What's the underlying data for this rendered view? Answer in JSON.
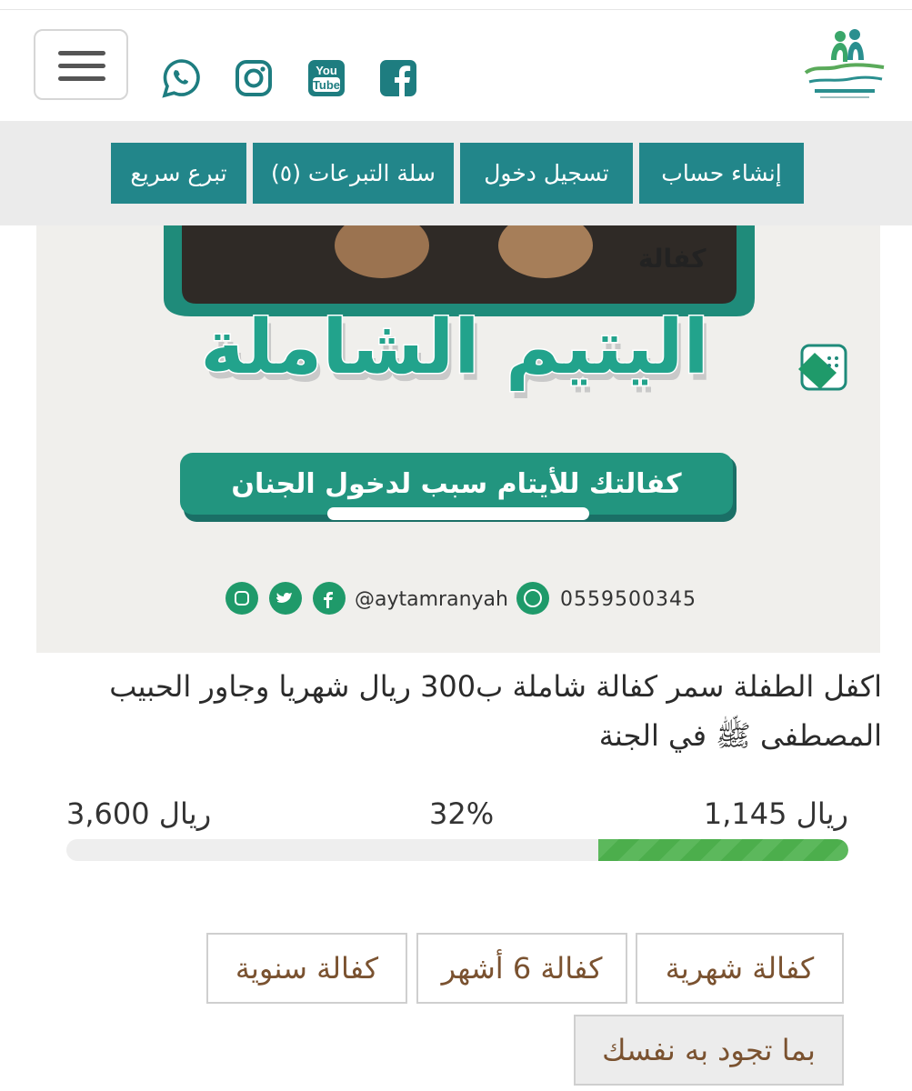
{
  "header": {
    "menu_label": "menu",
    "social": [
      "whatsapp-icon",
      "instagram-icon",
      "youtube-icon",
      "facebook-icon"
    ],
    "youtube_text_top": "You",
    "youtube_text_bottom": "Tube"
  },
  "nav": {
    "items": [
      {
        "label": "إنشاء حساب"
      },
      {
        "label": "تسجيل دخول"
      },
      {
        "label": "سلة التبرعات (٥)"
      },
      {
        "label": "تبرع سريع"
      }
    ]
  },
  "banner": {
    "caption_small": "كفالة",
    "caption_big": "اليتيم الشاملة",
    "tagline": "كفالتك للأيتام سبب لدخول الجنان",
    "handle": "@aytamranyah",
    "phone": "0559500345"
  },
  "campaign": {
    "title": "اكفل الطفلة سمر كفالة شاملة ب300 ريال شهريا وجاور الحبيب المصطفى ﷺ في الجنة",
    "raised": "1,145 ريال",
    "percent_text": "32%",
    "goal": "3,600 ريال",
    "progress": 0.32
  },
  "options": {
    "monthly": "كفالة شهرية",
    "six_months": "كفالة 6 أشهر",
    "yearly": "كفالة سنوية",
    "custom": "بما تجود به نفسك"
  },
  "colors": {
    "teal": "#22868a",
    "green": "#5cb85c",
    "brown": "#7a5230"
  }
}
